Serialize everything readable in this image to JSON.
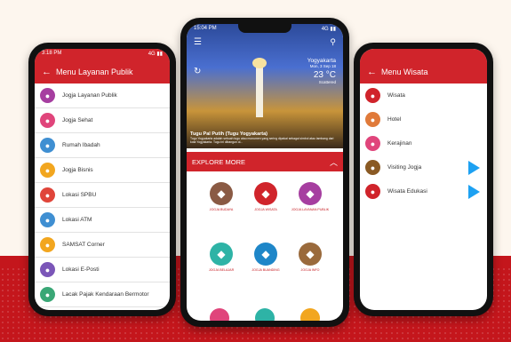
{
  "phone_left": {
    "status_time": "3:18 PM",
    "status_right": "4G ▮▮",
    "title": "Menu Layanan Publik",
    "items": [
      {
        "label": "Jogja Layanan Publik",
        "icon": "hand-icon",
        "color": "#a63ea0"
      },
      {
        "label": "Jogja Sehat",
        "icon": "stethoscope-icon",
        "color": "#e0457b"
      },
      {
        "label": "Rumah Ibadah",
        "icon": "mosque-icon",
        "color": "#3f8fd2"
      },
      {
        "label": "Jogja Bisnis",
        "icon": "handshake-icon",
        "color": "#f2a61f"
      },
      {
        "label": "Lokasi SPBU",
        "icon": "fuel-icon",
        "color": "#e0453a"
      },
      {
        "label": "Lokasi ATM",
        "icon": "atm-icon",
        "color": "#3f8fd2"
      },
      {
        "label": "SAMSAT Corner",
        "icon": "car-icon",
        "color": "#f2a61f"
      },
      {
        "label": "Lokasi E-Posti",
        "icon": "mail-icon",
        "color": "#7b56b8"
      },
      {
        "label": "Lacak Pajak Kendaraan Bermotor",
        "icon": "search-car-icon",
        "color": "#3aa776"
      }
    ]
  },
  "phone_center": {
    "status_time": "15:04 PM",
    "status_right": "4G ▮▮",
    "weather_city": "Yogyakarta",
    "weather_date": "Mon, 3 Sep 18",
    "weather_temp": "23 °C",
    "weather_extra": "Scattered",
    "hero_title": "Tugu Pal Putih (Tugu Yogyakarta)",
    "hero_desc": "Tugu Yogyakarta adalah sebuah tugu atau monumen yang sering dipakai sebagai simbol atau lambang dari kota Yogyakarta. Tugu ini dibangun ol...",
    "explore_label": "EXPLORE MORE",
    "grid": [
      {
        "label": "JOGJA BUDAYA",
        "icon": "scroll-icon",
        "color": "#8a5a44"
      },
      {
        "label": "JOGJA WISATA",
        "icon": "car-icon",
        "color": "#d0242b"
      },
      {
        "label": "JOGJA LAYANAN PUBLIK",
        "icon": "hand-icon",
        "color": "#a63ea0"
      },
      {
        "label": "JOGJA BELAJAR",
        "icon": "globe-icon",
        "color": "#2eb3a6"
      },
      {
        "label": "JOGJA BUANDING",
        "icon": "boat-icon",
        "color": "#1e86c8"
      },
      {
        "label": "JOGJA INFO",
        "icon": "building-icon",
        "color": "#9a6a3c"
      }
    ]
  },
  "phone_right": {
    "title": "Menu Wisata",
    "items": [
      {
        "label": "Wisata",
        "icon": "car-icon",
        "color": "#d0242b",
        "play": false
      },
      {
        "label": "Hotel",
        "icon": "hotel-icon",
        "color": "#e07a3a",
        "play": false
      },
      {
        "label": "Kerajinan",
        "icon": "craft-icon",
        "color": "#e0457b",
        "play": false
      },
      {
        "label": "Visiting Jogja",
        "icon": "monument-icon",
        "color": "#8a5a24",
        "play": true
      },
      {
        "label": "Wisata Edukasi",
        "icon": "book-icon",
        "color": "#d0242b",
        "play": true
      }
    ]
  }
}
